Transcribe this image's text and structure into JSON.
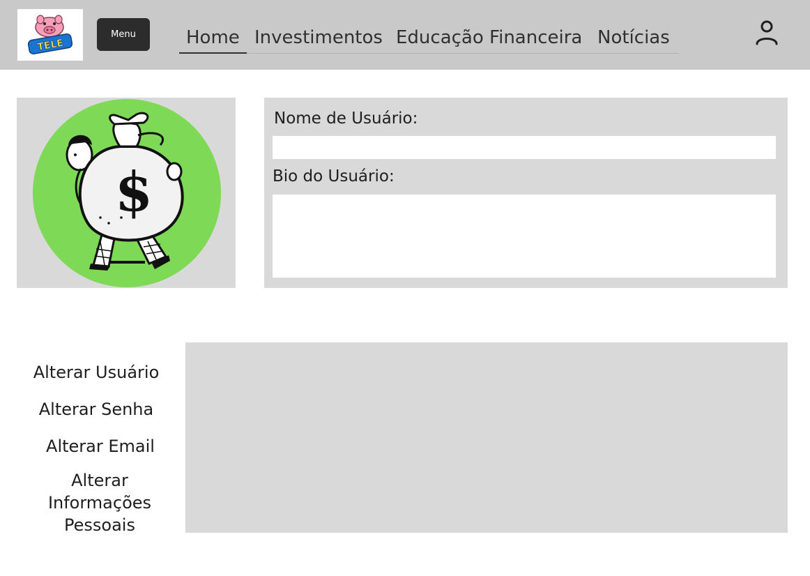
{
  "header": {
    "logo_text": "TELE",
    "menu_label": "Menu",
    "nav": [
      {
        "label": "Home",
        "active": true
      },
      {
        "label": "Investimentos",
        "active": false
      },
      {
        "label": "Educação Financeira",
        "active": false
      },
      {
        "label": "Notícias",
        "active": false
      }
    ],
    "user_icon": "person-icon"
  },
  "profile": {
    "avatar_icon": "money-bag-man-illustration",
    "avatar_bg_color": "#7ed957",
    "username_label": "Nome de Usuário:",
    "username_value": "",
    "bio_label": "Bio do Usuário:",
    "bio_value": ""
  },
  "settings": {
    "menu": [
      "Alterar Usuário",
      "Alterar Senha",
      "Alterar Email",
      "Alterar Informações Pessoais"
    ]
  },
  "colors": {
    "header_bg": "#c9c9c9",
    "panel_bg": "#d9d9d9",
    "button_bg": "#2c2c2c"
  }
}
